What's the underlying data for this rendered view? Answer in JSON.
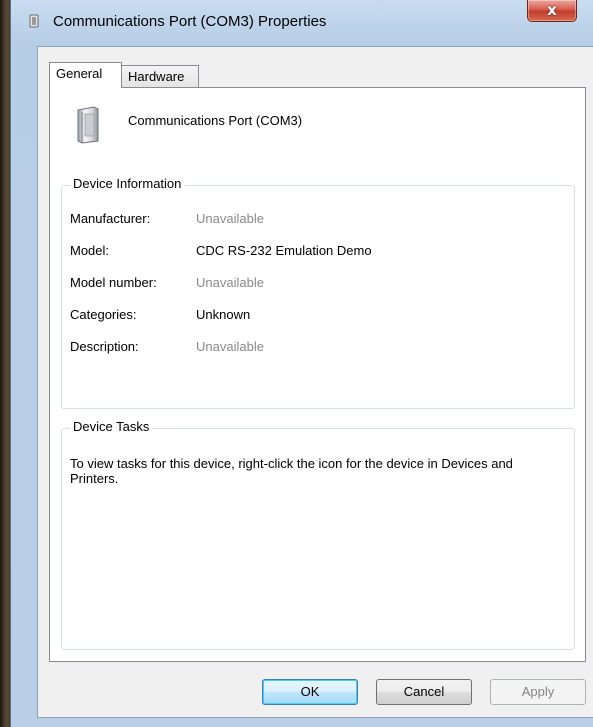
{
  "window": {
    "title": "Communications Port (COM3) Properties",
    "close_glyph": "x",
    "title_icon": "port-connector-icon"
  },
  "tabs": [
    {
      "label": "General",
      "selected": true
    },
    {
      "label": "Hardware",
      "selected": false
    }
  ],
  "device": {
    "icon": "com-port-device-icon",
    "name": "Communications Port (COM3)"
  },
  "device_information": {
    "legend": "Device Information",
    "rows": [
      {
        "label": "Manufacturer:",
        "value": "Unavailable",
        "available": false
      },
      {
        "label": "Model:",
        "value": "CDC RS-232 Emulation Demo",
        "available": true
      },
      {
        "label": "Model number:",
        "value": "Unavailable",
        "available": false
      },
      {
        "label": "Categories:",
        "value": "Unknown",
        "available": true
      },
      {
        "label": "Description:",
        "value": "Unavailable",
        "available": false
      }
    ]
  },
  "device_tasks": {
    "legend": "Device Tasks",
    "text": "To view tasks for this device, right-click the icon for the device in Devices and Printers."
  },
  "buttons": {
    "ok": "OK",
    "cancel": "Cancel",
    "apply": "Apply"
  },
  "colors": {
    "unavailable_text": "#8a8a8a",
    "close_button": "#c13b2c",
    "default_button_border": "#3c7fb1"
  }
}
